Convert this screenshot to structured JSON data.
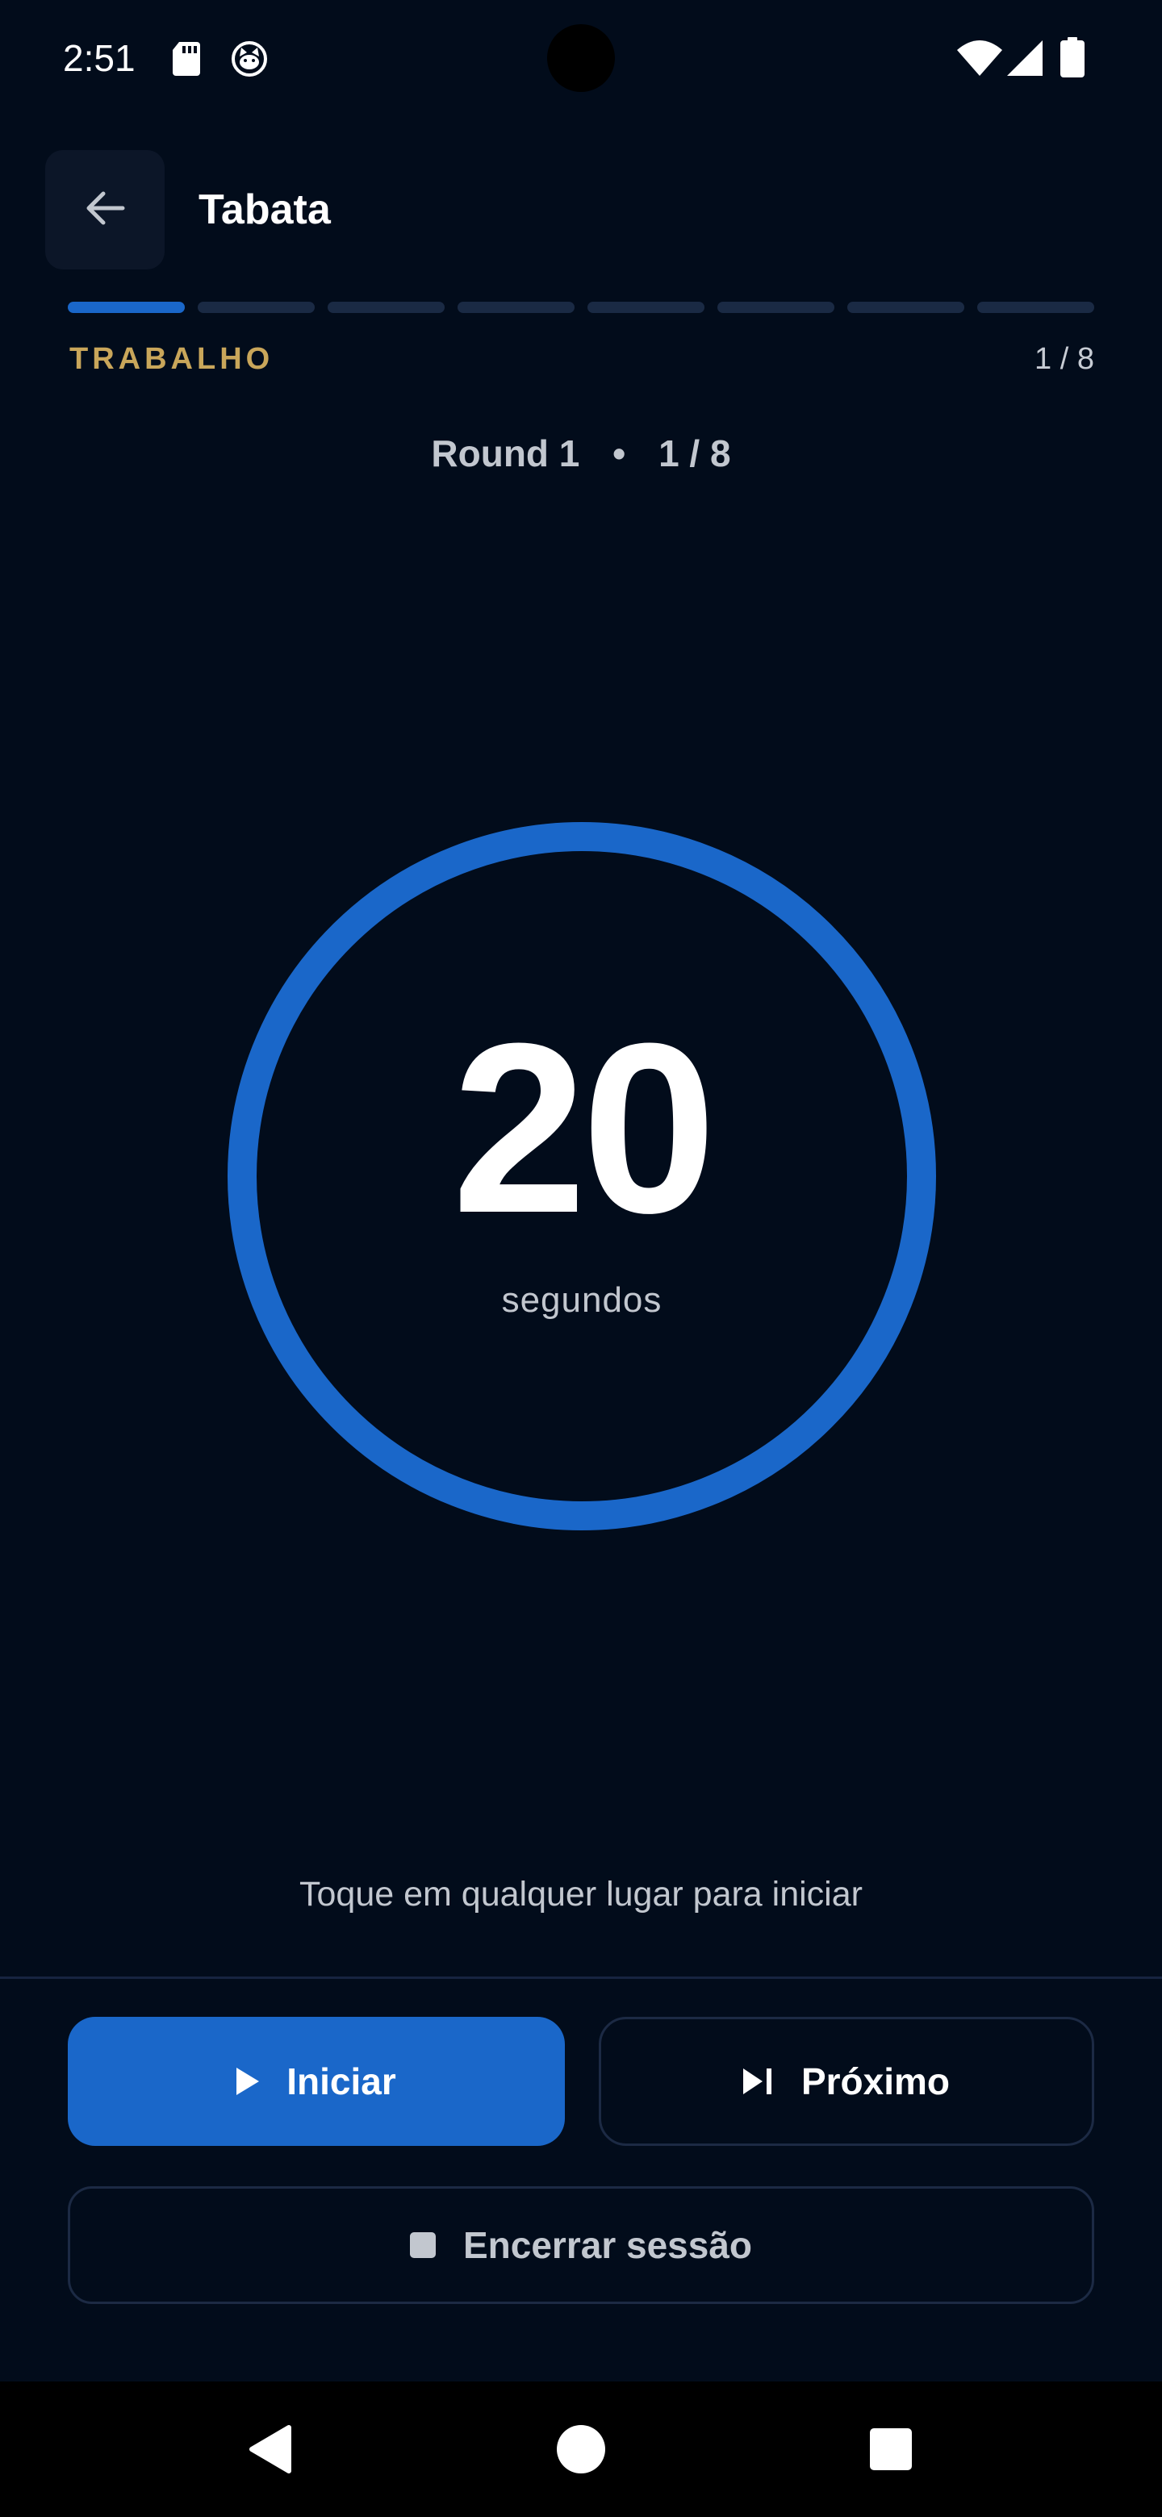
{
  "status_bar": {
    "time": "2:51",
    "icons": [
      "sd-card-icon",
      "cat-face-icon",
      "wifi-icon",
      "cell-signal-icon",
      "battery-icon"
    ]
  },
  "app_bar": {
    "back_icon": "arrow-left-icon",
    "title": "Tabata"
  },
  "progress": {
    "total_segments": 8,
    "current_segment": 1,
    "phase_label": "TRABALHO",
    "phase_count": "1 / 8",
    "active_color": "#1a67c9",
    "inactive_color": "#1a2a44"
  },
  "round": {
    "label": "Round 1",
    "separator": "•",
    "count": "1 / 8"
  },
  "timer": {
    "value": "20",
    "unit": "segundos",
    "ring_color": "#1a67c9",
    "ring_progress": 1.0
  },
  "hint": "Toque em qualquer lugar para iniciar",
  "actions": {
    "start_label": "Iniciar",
    "next_label": "Próximo",
    "end_label": "Encerrar sessão"
  },
  "nav_bar": {
    "icons": [
      "nav-back-icon",
      "nav-home-icon",
      "nav-recents-icon"
    ]
  },
  "colors": {
    "background": "#020c1b",
    "accent": "#1a67c9",
    "phase": "#c9a65a"
  }
}
